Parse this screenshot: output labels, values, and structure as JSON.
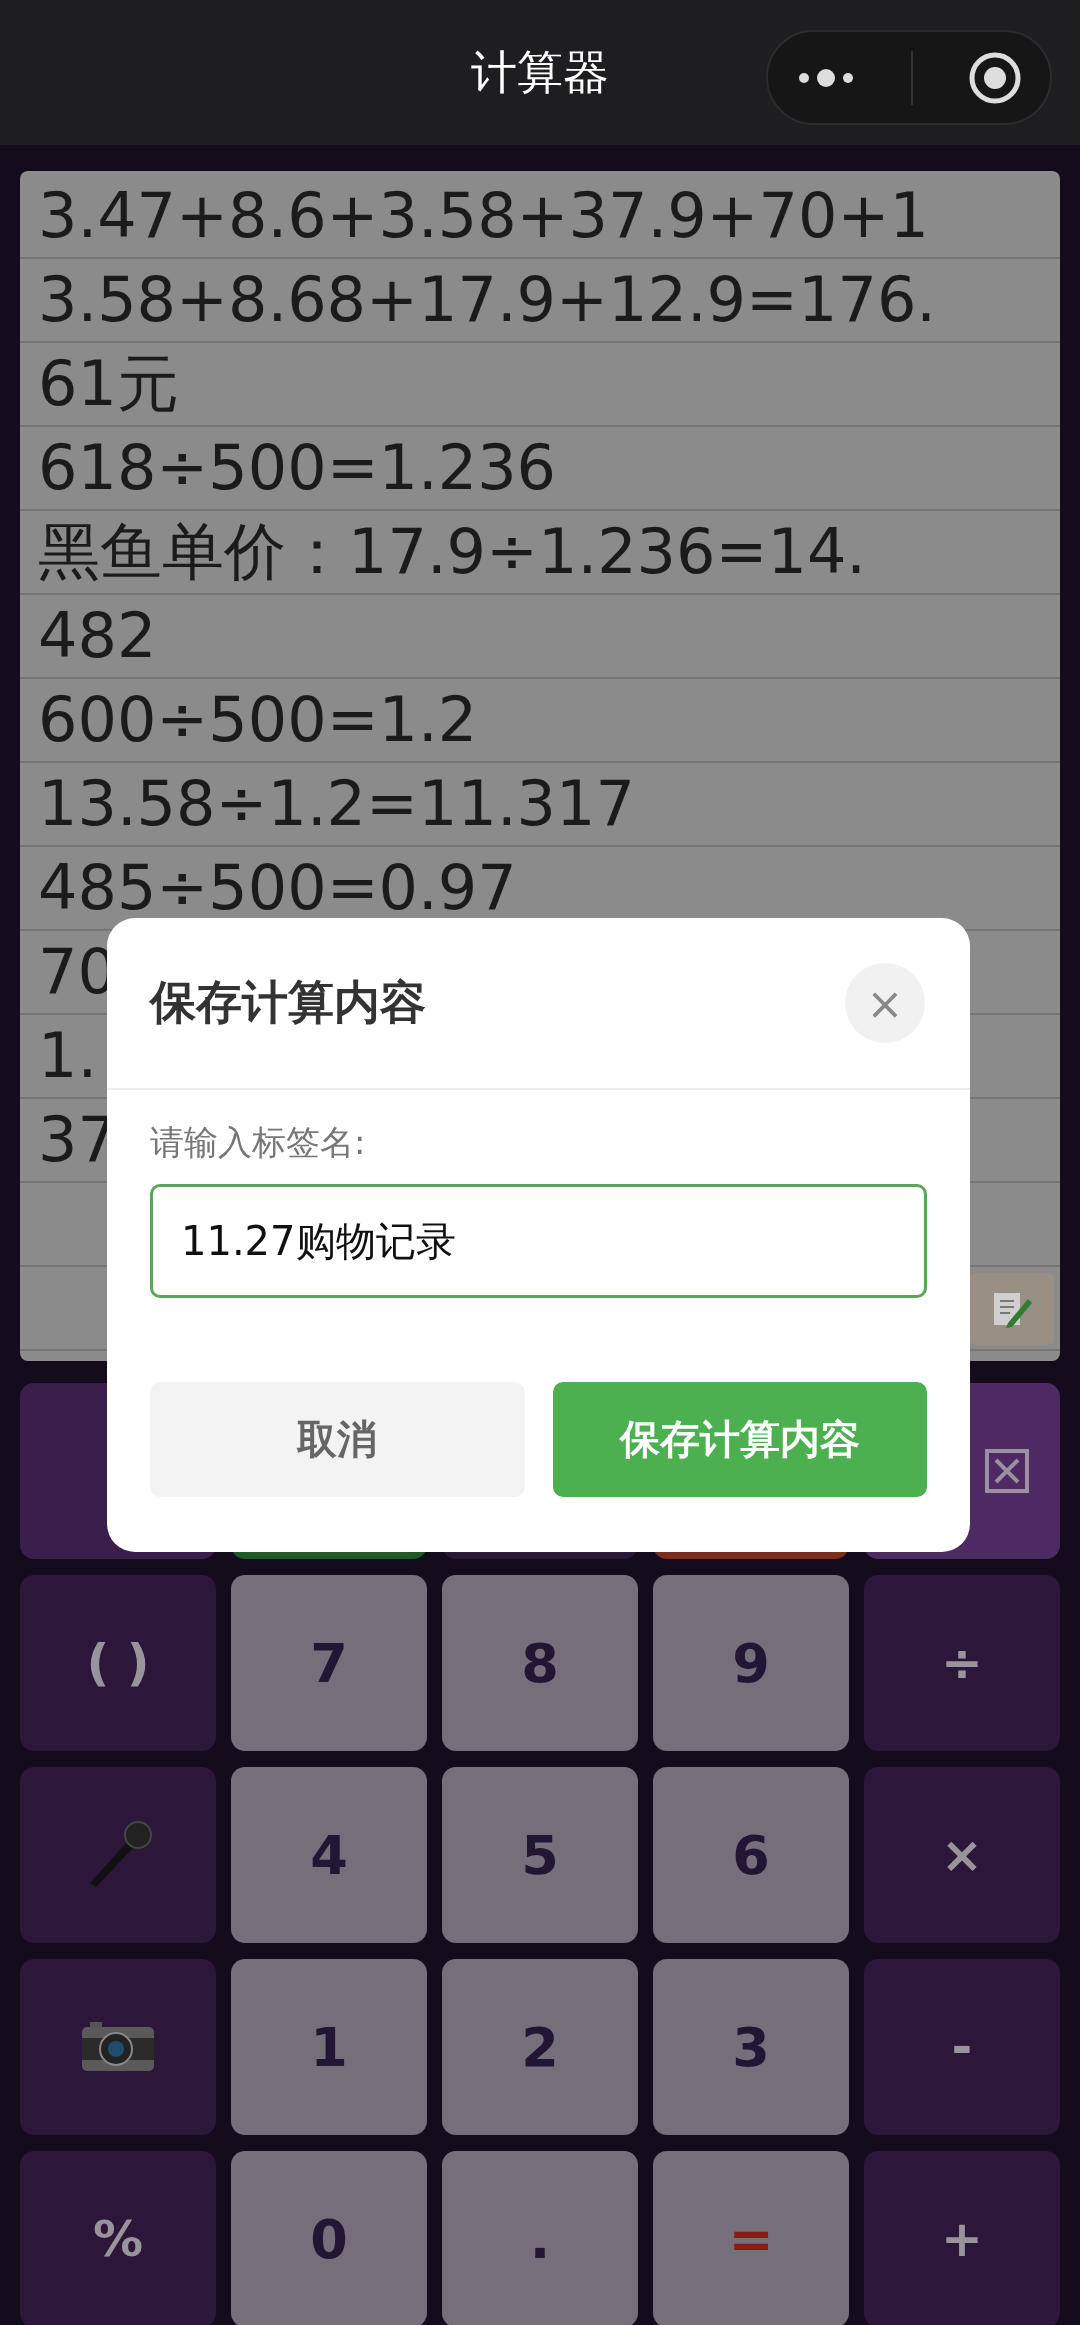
{
  "nav": {
    "title": "计算器"
  },
  "notes": {
    "lines": [
      "3.47+8.6+3.58+37.9+70+1",
      "3.58+8.68+17.9+12.9=176.",
      "61元",
      "618÷500=1.236",
      "黑鱼单价：17.9÷1.236=14.",
      "482",
      "600÷500=1.2",
      "13.58÷1.2=11.317",
      "485÷500=0.97",
      "70",
      "1.",
      "37"
    ]
  },
  "keypad": {
    "rows": [
      [
        {
          "kind": "blank",
          "color": "#3a1f4d"
        },
        {
          "kind": "blank",
          "color": "#1f5a26"
        },
        {
          "kind": "blank",
          "color": "#2a1836"
        },
        {
          "kind": "blank",
          "color": "#7a2e1b"
        },
        {
          "kind": "backspace",
          "color": "#4d2b62"
        }
      ],
      [
        {
          "kind": "operator",
          "label": "( )"
        },
        {
          "kind": "digit",
          "label": "7"
        },
        {
          "kind": "digit",
          "label": "8"
        },
        {
          "kind": "digit",
          "label": "9"
        },
        {
          "kind": "operator",
          "label": "÷"
        }
      ],
      [
        {
          "kind": "microphone"
        },
        {
          "kind": "digit",
          "label": "4"
        },
        {
          "kind": "digit",
          "label": "5"
        },
        {
          "kind": "digit",
          "label": "6"
        },
        {
          "kind": "operator",
          "label": "×"
        }
      ],
      [
        {
          "kind": "camera"
        },
        {
          "kind": "digit",
          "label": "1"
        },
        {
          "kind": "digit",
          "label": "2"
        },
        {
          "kind": "digit",
          "label": "3"
        },
        {
          "kind": "operator",
          "label": "-"
        }
      ],
      [
        {
          "kind": "operator",
          "label": "%"
        },
        {
          "kind": "digit",
          "label": "0"
        },
        {
          "kind": "digit",
          "label": "."
        },
        {
          "kind": "equals",
          "label": "="
        },
        {
          "kind": "operator",
          "label": "+"
        }
      ]
    ]
  },
  "dialog": {
    "title": "保存计算内容",
    "close": "×",
    "field_label": "请输入标签名:",
    "value": "11.27购物记录",
    "buttons": [
      {
        "kind": "cancel",
        "label": "取消"
      },
      {
        "kind": "confirm",
        "label": "保存计算内容"
      }
    ]
  }
}
